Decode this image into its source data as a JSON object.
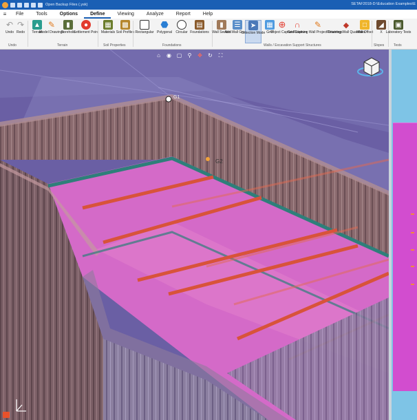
{
  "titlebar": {
    "quick_access_text": "Open Backup Files (.ysk)",
    "path": "SETAF2018-D:\\Education Examples\\E"
  },
  "menu": {
    "hamburger": "≡",
    "items": [
      "File",
      "Tools",
      "Options",
      "Define",
      "Viewing",
      "Analyze",
      "Report",
      "Help"
    ],
    "active": "Define"
  },
  "ribbon": {
    "buttons": [
      {
        "label": "Undo",
        "icon": "undo-icon"
      },
      {
        "label": "Redo",
        "icon": "redo-icon"
      },
      {
        "label": "Terrain",
        "icon": "terrain-icon"
      },
      {
        "label": "Model Drawings",
        "icon": "pencil-icon"
      },
      {
        "label": "Borehole",
        "icon": "borehole-icon"
      },
      {
        "label": "Settlement Point",
        "icon": "settlement-point-icon"
      },
      {
        "label": "Materials",
        "icon": "materials-icon"
      },
      {
        "label": "Soil Profiles",
        "icon": "soil-profiles-icon"
      },
      {
        "label": "Rectangular",
        "icon": "rectangle-icon"
      },
      {
        "label": "Polygonal",
        "icon": "polygon-icon"
      },
      {
        "label": "Circular",
        "icon": "circle-icon"
      },
      {
        "label": "Foundations",
        "icon": "foundations-icon"
      },
      {
        "label": "Wall Section",
        "icon": "wall-section-icon"
      },
      {
        "label": "Add Wall Groups",
        "icon": "wall-groups-icon"
      },
      {
        "label": "Selection Mode",
        "icon": "cursor-icon"
      },
      {
        "label": "Grid",
        "icon": "grid-icon"
      },
      {
        "label": "Object Capture",
        "icon": "object-capture-icon"
      },
      {
        "label": "Grid Capture",
        "icon": "magnet-icon"
      },
      {
        "label": "Retaining Wall Project Drawings",
        "icon": "drawing-icon"
      },
      {
        "label": "Retaining Wall Quantities",
        "icon": "quantities-icon"
      },
      {
        "label": "Wall Offset",
        "icon": "wall-offset-icon"
      },
      {
        "label": "X",
        "icon": "slope-icon"
      },
      {
        "label": "Laboratory Tests",
        "icon": "laboratory-icon"
      }
    ],
    "groups": [
      "Undo",
      "Terrain",
      "Soil Properties",
      "Foundations",
      "Walls / Excavation Support Structures",
      "Slopes",
      "Tests"
    ]
  },
  "viewport": {
    "tools": [
      "home-icon",
      "view-icon",
      "zoom-window-icon",
      "zoom-icon",
      "pan-icon",
      "rotate-icon",
      "fit-icon"
    ],
    "label_g1": "G1",
    "label_g2": "G2"
  },
  "colors": {
    "titlebar": "#1a5fb4",
    "viewport_bg": "#6b62a6",
    "wall": "#7a5e64",
    "strut": "#d8533a",
    "floor": "#d46ac8",
    "side_panel": "#7ec4e6"
  }
}
